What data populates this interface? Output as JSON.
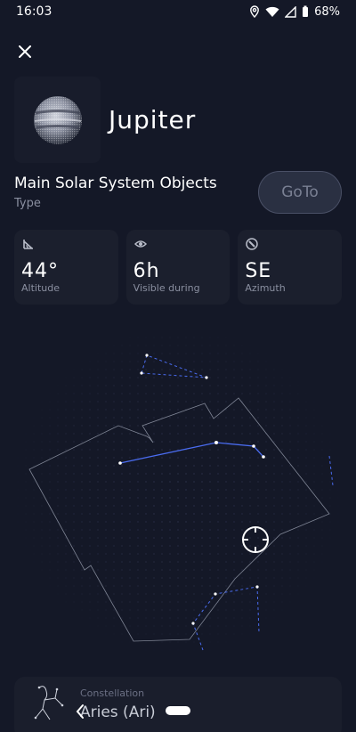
{
  "status_bar": {
    "time": "16:03",
    "battery": "68%"
  },
  "object": {
    "name": "Jupiter",
    "category": "Main Solar System Objects",
    "category_label": "Type"
  },
  "actions": {
    "goto_label": "GoTo"
  },
  "stats": [
    {
      "value": "44°",
      "label": "Altitude",
      "icon": "angle-icon"
    },
    {
      "value": "6h",
      "label": "Visible during",
      "icon": "eye-icon"
    },
    {
      "value": "SE",
      "label": "Azimuth",
      "icon": "compass-icon"
    }
  ],
  "constellation": {
    "label": "Constellation",
    "name": "Aries (Ari)"
  },
  "colors": {
    "background": "#141827",
    "card": "#1b1f2d",
    "constellation_line": "#4a6cf0"
  }
}
